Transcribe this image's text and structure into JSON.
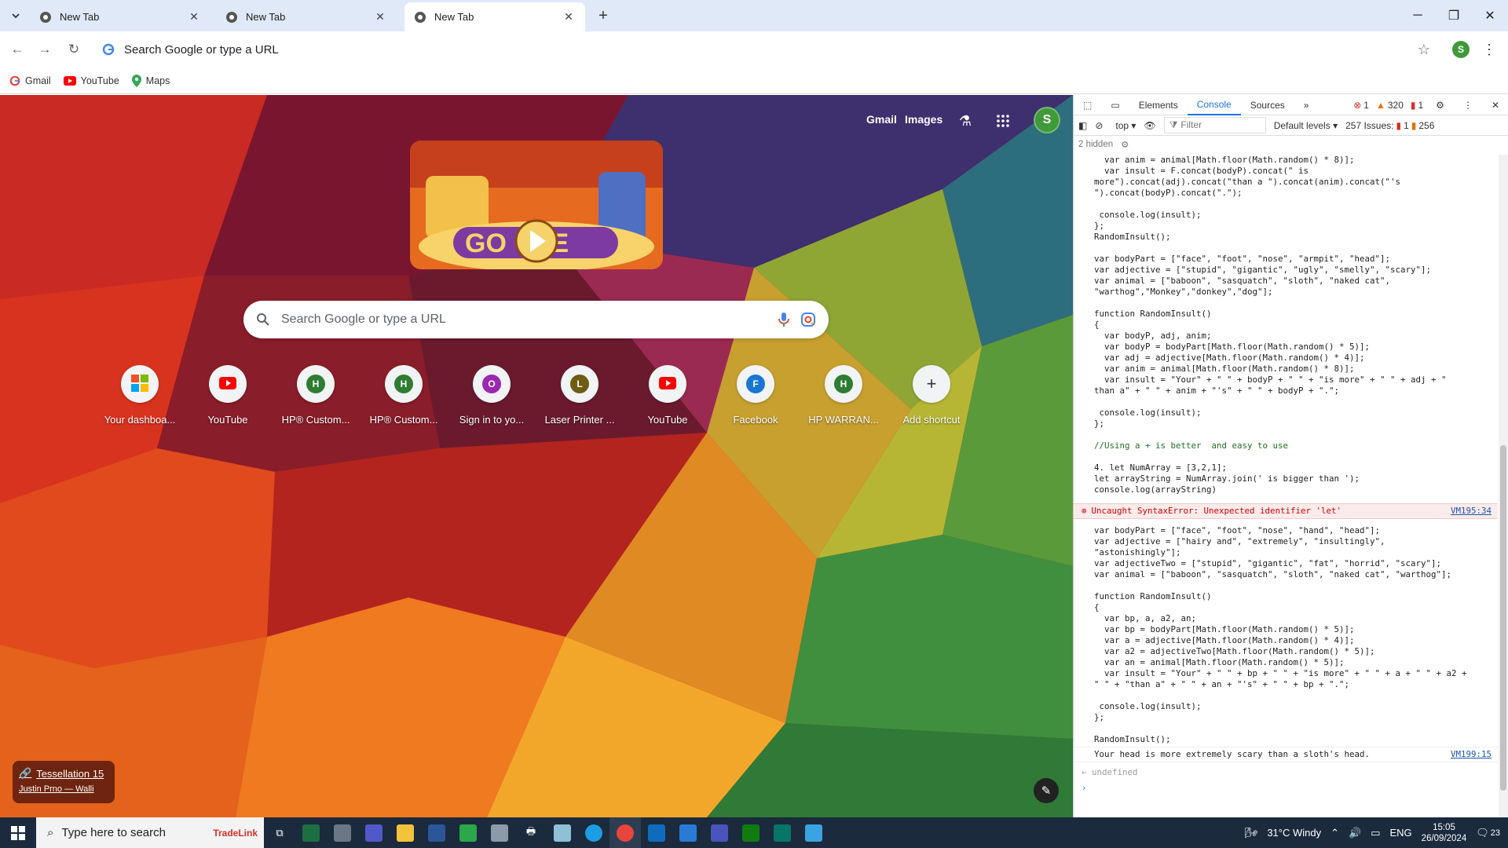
{
  "browser": {
    "tabs": [
      {
        "title": "New Tab",
        "active": false
      },
      {
        "title": "New Tab",
        "active": false
      },
      {
        "title": "New Tab",
        "active": true
      }
    ],
    "omnibox_placeholder": "Search Google or type a URL",
    "profile_initial": "S",
    "bookmarks": [
      {
        "label": "Gmail",
        "icon": "google-icon"
      },
      {
        "label": "YouTube",
        "icon": "youtube-icon"
      },
      {
        "label": "Maps",
        "icon": "maps-icon"
      }
    ]
  },
  "ntp": {
    "links": {
      "gmail": "Gmail",
      "images": "Images"
    },
    "avatar_initial": "S",
    "search_placeholder": "Search Google or type a URL",
    "shortcuts": [
      {
        "label": "Your dashboa...",
        "icon": "windows-tiles-icon",
        "color": "#f25022",
        "letter": ""
      },
      {
        "label": "YouTube",
        "icon": "youtube-icon",
        "color": "#ff0000",
        "letter": ""
      },
      {
        "label": "HP® Custom...",
        "icon": "letter-icon",
        "color": "#2e7d32",
        "letter": "H"
      },
      {
        "label": "HP® Custom...",
        "icon": "letter-icon",
        "color": "#2e7d32",
        "letter": "H"
      },
      {
        "label": "Sign in to yo...",
        "icon": "letter-icon",
        "color": "#9c27b0",
        "letter": "O"
      },
      {
        "label": "Laser Printer ...",
        "icon": "letter-icon",
        "color": "#6d5d13",
        "letter": "L"
      },
      {
        "label": "YouTube",
        "icon": "youtube-icon",
        "color": "#ff0000",
        "letter": ""
      },
      {
        "label": "Facebook",
        "icon": "letter-icon",
        "color": "#1877d2",
        "letter": "F"
      },
      {
        "label": "HP WARRAN...",
        "icon": "letter-icon",
        "color": "#2e7d32",
        "letter": "H"
      },
      {
        "label": "Add shortcut",
        "icon": "plus-icon",
        "color": "#f1f3f4",
        "letter": "+"
      }
    ],
    "attribution": {
      "title": "Tessellation 15",
      "author": "Justin Prno — Walli"
    }
  },
  "devtools": {
    "tabs": [
      "Elements",
      "Console",
      "Sources"
    ],
    "active_tab": "Console",
    "counts": {
      "errors": "1",
      "warnings": "320",
      "info": "1"
    },
    "context": "top",
    "filter_placeholder": "Filter",
    "levels": "Default levels",
    "issues": {
      "label": "257 Issues:",
      "errors": "1",
      "warnings": "256"
    },
    "hidden": "2 hidden",
    "block1": [
      "  var anim = animal[Math.floor(Math.random() * 8)];",
      "  var insult = F.concat(bodyP).concat(\" is",
      "more\").concat(adj).concat(\"than a \").concat(anim).concat(\"'s",
      "\").concat(bodyP).concat(\".\");",
      "",
      " console.log(insult);",
      "};",
      "RandomInsult();",
      "",
      "var bodyPart = [\"face\", \"foot\", \"nose\", \"armpit\", \"head\"];",
      "var adjective = [\"stupid\", \"gigantic\", \"ugly\", \"smelly\", \"scary\"];",
      "var animal = [\"baboon\", \"sasquatch\", \"sloth\", \"naked cat\",",
      "\"warthog\",\"Monkey\",\"donkey\",\"dog\"];",
      "",
      "function RandomInsult()",
      "{",
      "  var bodyP, adj, anim;",
      "  var bodyP = bodyPart[Math.floor(Math.random() * 5)];",
      "  var adj = adjective[Math.floor(Math.random() * 4)];",
      "  var anim = animal[Math.floor(Math.random() * 8)];",
      "  var insult = \"Your\" + \" \" + bodyP + \" \" + \"is more\" + \" \" + adj + \"",
      "than a\" + \" \" + anim + \"'s\" + \" \" + bodyP + \".\";",
      "",
      " console.log(insult);",
      "};",
      "",
      "//Using a + is better  and easy to use",
      "",
      "4. let NumArray = [3,2,1];",
      "let arrayString = NumArray.join(' is bigger than ');",
      "console.log(arrayString)"
    ],
    "error": {
      "text": "Uncaught SyntaxError: Unexpected identifier 'let'",
      "source": "VM195:34"
    },
    "block2": [
      "var bodyPart = [\"face\", \"foot\", \"nose\", \"hand\", \"head\"];",
      "var adjective = [\"hairy and\", \"extremely\", \"insultingly\",",
      "\"astonishingly\"];",
      "var adjectiveTwo = [\"stupid\", \"gigantic\", \"fat\", \"horrid\", \"scary\"];",
      "var animal = [\"baboon\", \"sasquatch\", \"sloth\", \"naked cat\", \"warthog\"];",
      "",
      "function RandomInsult()",
      "{",
      "  var bp, a, a2, an;",
      "  var bp = bodyPart[Math.floor(Math.random() * 5)];",
      "  var a = adjective[Math.floor(Math.random() * 4)];",
      "  var a2 = adjectiveTwo[Math.floor(Math.random() * 5)];",
      "  var an = animal[Math.floor(Math.random() * 5)];",
      "  var insult = \"Your\" + \" \" + bp + \" \" + \"is more\" + \" \" + a + \" \" + a2 +",
      "\" \" + \"than a\" + \" \" + an + \"'s\" + \" \" + bp + \".\";",
      "",
      " console.log(insult);",
      "};",
      "",
      "RandomInsult();"
    ],
    "output": {
      "text": "Your head is more extremely scary than a sloth's head.",
      "source": "VM199:15"
    },
    "return_value": "undefined"
  },
  "taskbar": {
    "search_placeholder": "Type here to search",
    "weather": "31°C  Windy",
    "language": "ENG",
    "time": "15:05",
    "date": "26/09/2024",
    "notification_count": "23"
  },
  "colors": {
    "accent": "#1a73e8",
    "error": "#d93025",
    "warning": "#e37400"
  }
}
